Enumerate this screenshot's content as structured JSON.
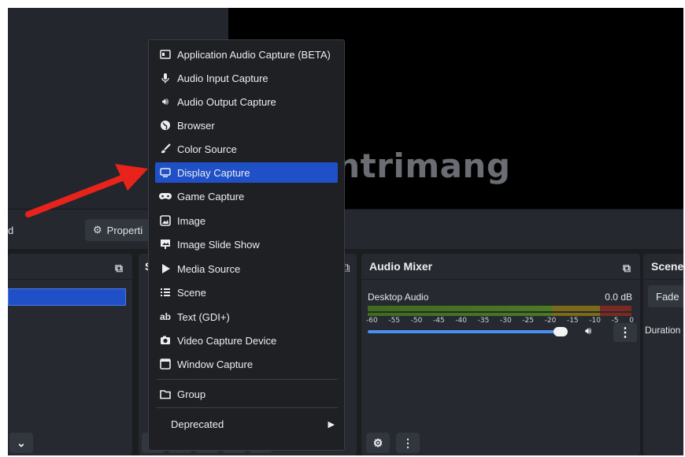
{
  "toolbar": {
    "fragment_text": "d",
    "properties_label": "Properti"
  },
  "watermark": {
    "text": "uantrimang"
  },
  "docks": {
    "sources_initial": "S",
    "audio_mixer": {
      "title": "Audio Mixer",
      "channel_name": "Desktop Audio",
      "db_value": "0.0 dB",
      "ticks": [
        "-60",
        "-55",
        "-50",
        "-45",
        "-40",
        "-35",
        "-30",
        "-25",
        "-20",
        "-15",
        "-10",
        "-5",
        "0"
      ],
      "volume_fraction": 0.94
    },
    "scene_transitions": {
      "title": "Scene",
      "transition": "Fade",
      "duration_label": "Duration"
    }
  },
  "context_menu": {
    "items": [
      {
        "label": "Application Audio Capture (BETA)",
        "icon": "app-audio-icon"
      },
      {
        "label": "Audio Input Capture",
        "icon": "microphone-icon"
      },
      {
        "label": "Audio Output Capture",
        "icon": "speaker-icon"
      },
      {
        "label": "Browser",
        "icon": "globe-icon"
      },
      {
        "label": "Color Source",
        "icon": "brush-icon"
      },
      {
        "label": "Display Capture",
        "icon": "monitor-icon",
        "selected": true
      },
      {
        "label": "Game Capture",
        "icon": "gamepad-icon"
      },
      {
        "label": "Image",
        "icon": "image-icon"
      },
      {
        "label": "Image Slide Show",
        "icon": "slideshow-icon"
      },
      {
        "label": "Media Source",
        "icon": "play-icon"
      },
      {
        "label": "Scene",
        "icon": "list-icon"
      },
      {
        "label": "Text (GDI+)",
        "icon": "text-icon"
      },
      {
        "label": "Video Capture Device",
        "icon": "camera-icon"
      },
      {
        "label": "Window Capture",
        "icon": "window-icon"
      }
    ],
    "group_label": "Group",
    "deprecated_label": "Deprecated"
  },
  "colors": {
    "selection": "#1f50c7",
    "arrow": "#e8231b"
  }
}
